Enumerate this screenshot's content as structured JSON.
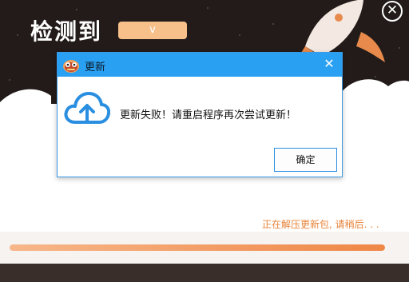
{
  "app": {
    "title": "检测到",
    "version_label": "v",
    "close_glyph": "✕"
  },
  "status": {
    "text": "正在解压更新包, 请稍后. . ."
  },
  "progress": {
    "fraction": 1.0
  },
  "dialog": {
    "title": "更新",
    "close_glyph": "✕",
    "message": "更新失败！请重启程序再次尝试更新！",
    "ok_label": "确定",
    "icon": "cloud-upload-icon",
    "app_icon": "app-logo-icon"
  },
  "colors": {
    "titlebar": "#2aa0f2",
    "accent_orange": "#e8843a",
    "cloud_blue": "#2a8fe0"
  }
}
